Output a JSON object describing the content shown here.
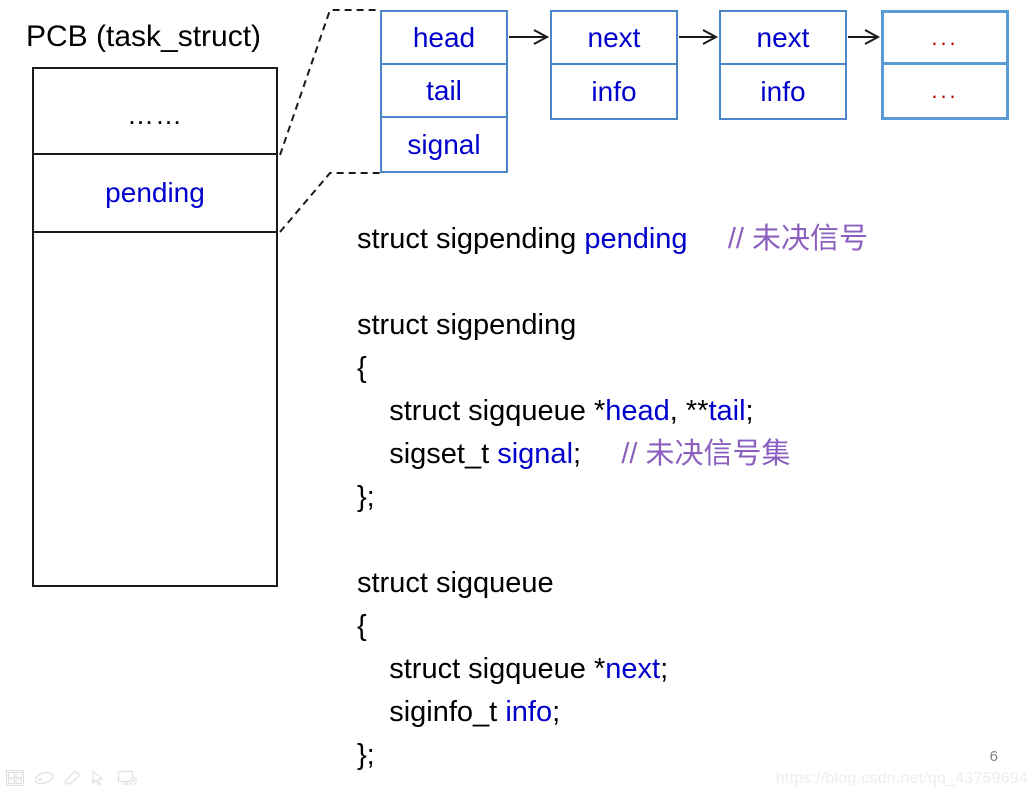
{
  "slide": {
    "pcb_title": "PCB (task_struct)",
    "page_number": "6",
    "watermark": "https://blog.csdn.net/qq_43759694"
  },
  "colors": {
    "field_blue": "#0000CC",
    "node_border": "#4A86C8",
    "node_border_last": "#5B9BD5",
    "comment_purple": "#8B5FBF",
    "dots_red": "#C00000",
    "outline_black": "#1A1A1A"
  },
  "pcb_box": {
    "rows": [
      {
        "label": "……",
        "style": "dots"
      },
      {
        "label": "pending",
        "style": "field"
      },
      {
        "label": "",
        "style": "empty"
      }
    ]
  },
  "nodes": [
    {
      "name": "sigpending",
      "cells": [
        "head",
        "tail",
        "signal"
      ]
    },
    {
      "name": "sigqueue-1",
      "cells": [
        "next",
        "info"
      ]
    },
    {
      "name": "sigqueue-2",
      "cells": [
        "next",
        "info"
      ]
    },
    {
      "name": "sigqueue-more",
      "cells": [
        "...",
        "..."
      ]
    }
  ],
  "code": {
    "lines": [
      {
        "id": "decl-pending",
        "segments": [
          {
            "text": "struct sigpending ",
            "kind": "plain"
          },
          {
            "text": "pending",
            "kind": "blue"
          },
          {
            "text": "     ",
            "kind": "plain"
          },
          {
            "text": "// 未决信号",
            "kind": "comment"
          }
        ]
      },
      {
        "id": "blank-1",
        "segments": []
      },
      {
        "id": "sigpending-head",
        "segments": [
          {
            "text": "struct sigpending",
            "kind": "plain"
          }
        ]
      },
      {
        "id": "sigpending-open",
        "segments": [
          {
            "text": "{",
            "kind": "plain"
          }
        ]
      },
      {
        "id": "sigpending-members-1",
        "segments": [
          {
            "text": "    struct sigqueue *",
            "kind": "plain"
          },
          {
            "text": "head",
            "kind": "blue"
          },
          {
            "text": ", **",
            "kind": "plain"
          },
          {
            "text": "tail",
            "kind": "blue"
          },
          {
            "text": ";",
            "kind": "plain"
          }
        ]
      },
      {
        "id": "sigpending-members-2",
        "segments": [
          {
            "text": "    sigset_t ",
            "kind": "plain"
          },
          {
            "text": "signal",
            "kind": "blue"
          },
          {
            "text": ";     ",
            "kind": "plain"
          },
          {
            "text": "// 未决信号集",
            "kind": "comment"
          }
        ]
      },
      {
        "id": "sigpending-close",
        "segments": [
          {
            "text": "};",
            "kind": "plain"
          }
        ]
      },
      {
        "id": "blank-2",
        "segments": []
      },
      {
        "id": "sigqueue-head",
        "segments": [
          {
            "text": "struct sigqueue",
            "kind": "plain"
          }
        ]
      },
      {
        "id": "sigqueue-open",
        "segments": [
          {
            "text": "{",
            "kind": "plain"
          }
        ]
      },
      {
        "id": "sigqueue-members-1",
        "segments": [
          {
            "text": "    struct sigqueue *",
            "kind": "plain"
          },
          {
            "text": "next",
            "kind": "blue"
          },
          {
            "text": ";",
            "kind": "plain"
          }
        ]
      },
      {
        "id": "sigqueue-members-2",
        "segments": [
          {
            "text": "    siginfo_t ",
            "kind": "plain"
          },
          {
            "text": "info",
            "kind": "blue"
          },
          {
            "text": ";",
            "kind": "plain"
          }
        ]
      },
      {
        "id": "sigqueue-close",
        "segments": [
          {
            "text": "};",
            "kind": "plain"
          }
        ]
      }
    ]
  },
  "toolbar": {
    "icons": [
      "slide-navigator-icon",
      "pen-icon",
      "highlighter-icon",
      "pointer-icon",
      "display-settings-icon"
    ]
  }
}
